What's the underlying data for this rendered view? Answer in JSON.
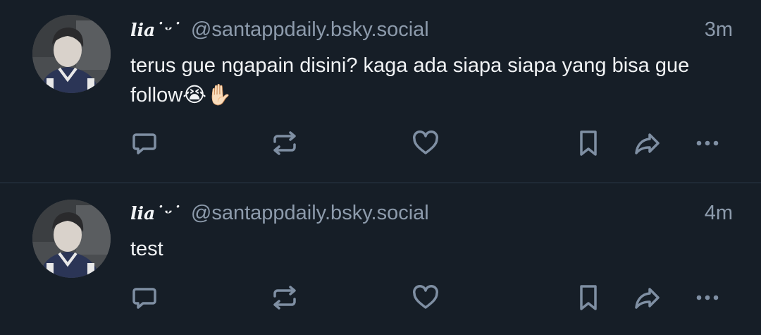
{
  "posts": [
    {
      "display_name": "lia˙ᵕ˙",
      "handle": "@santappdaily.bsky.social",
      "time": "3m",
      "text": "terus gue ngapain disini? kaga ada siapa siapa yang bisa gue follow😭✋🏻",
      "avatar_icon": "profile-photo",
      "actions": [
        "reply-icon",
        "repost-icon",
        "like-icon",
        "bookmark-icon",
        "share-icon",
        "more-icon"
      ]
    },
    {
      "display_name": "lia˙ᵕ˙",
      "handle": "@santappdaily.bsky.social",
      "time": "4m",
      "text": "test",
      "avatar_icon": "profile-photo",
      "actions": [
        "reply-icon",
        "repost-icon",
        "like-icon",
        "bookmark-icon",
        "share-icon",
        "more-icon"
      ]
    }
  ],
  "colors": {
    "background": "#161e27",
    "text": "#f1f3f5",
    "muted": "#8d9bac",
    "icon": "#7f8fa3",
    "divider": "#1f2a36"
  }
}
